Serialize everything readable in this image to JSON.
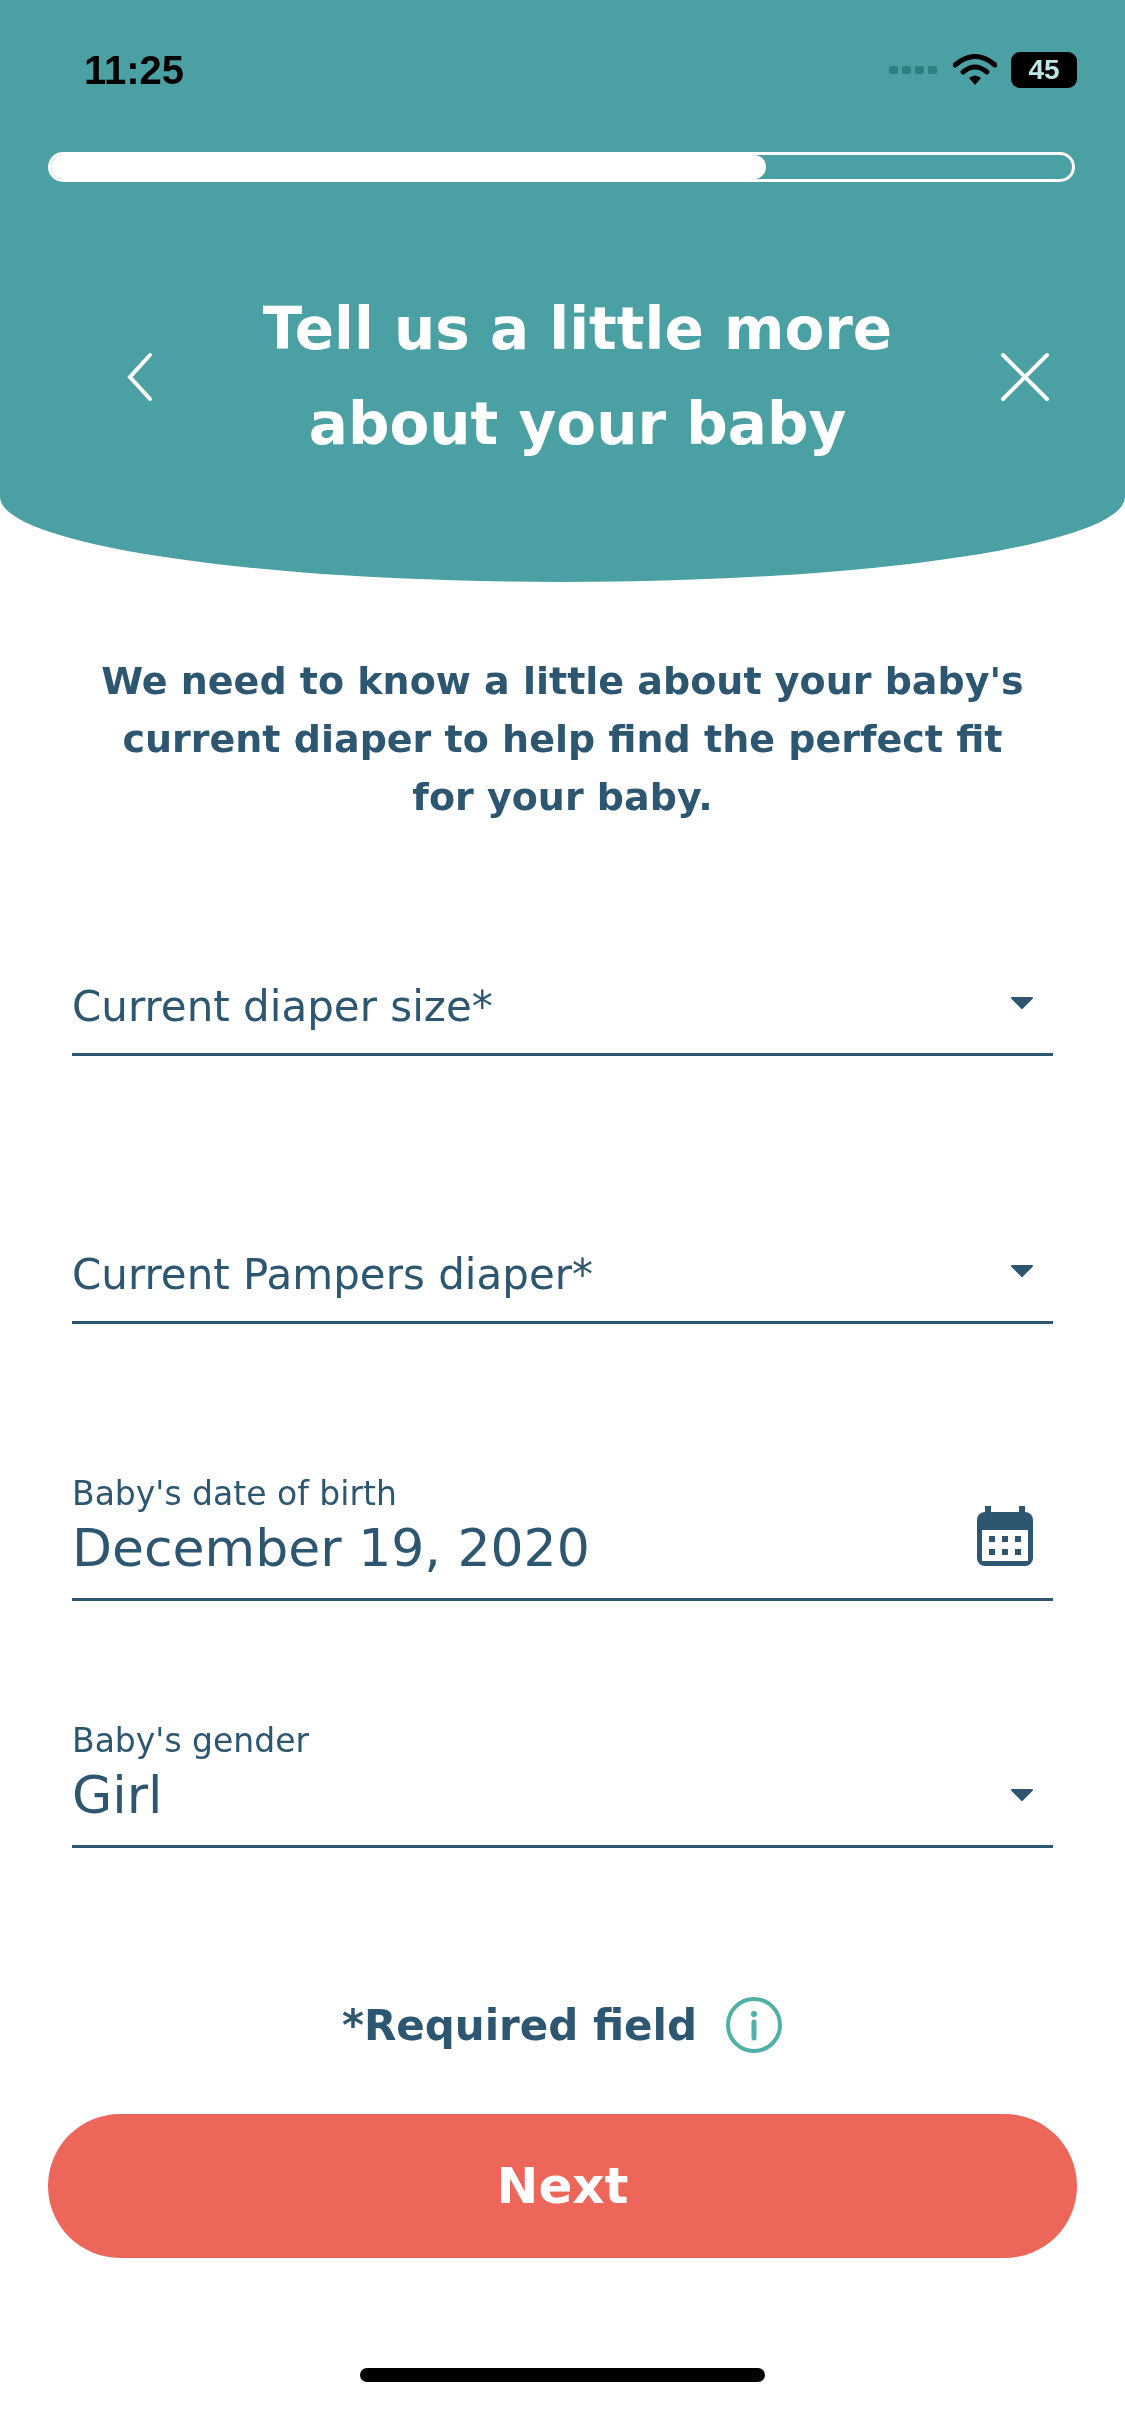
{
  "status_bar": {
    "time": "11:25",
    "battery": "45"
  },
  "header": {
    "progress": {
      "level": 0.7
    },
    "title": "Tell us a little more about your baby"
  },
  "intro": "We need to know a little about your baby's current diaper to help find the perfect fit for your baby.",
  "fields": [
    {
      "kind": "select",
      "placeholder": "Current diaper size*"
    },
    {
      "kind": "select",
      "placeholder": "Current Pampers diaper*"
    },
    {
      "kind": "date",
      "label": "Baby's date of birth",
      "value": "December 19, 2020"
    },
    {
      "kind": "select",
      "label": "Baby's gender",
      "value": "Girl"
    }
  ],
  "required_note": "*Required field",
  "next_button": "Next"
}
